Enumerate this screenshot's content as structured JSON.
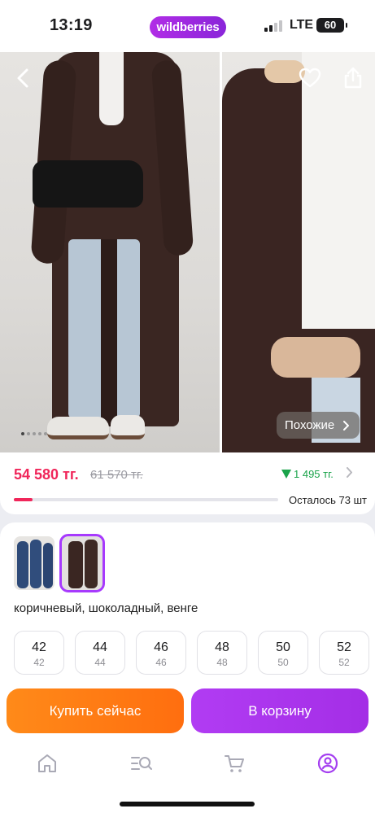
{
  "status_bar": {
    "time": "13:19",
    "brand": "wildberries",
    "network": "LTE",
    "battery": "60"
  },
  "gallery": {
    "back_icon": "chevron-left-icon",
    "favorite_icon": "heart-icon",
    "share_icon": "share-icon",
    "similar_label": "Похожие",
    "page_count": 5,
    "active_page": 1
  },
  "price": {
    "current": "54 580 тг.",
    "old": "61 570 тг.",
    "discount": "1 495 тг.",
    "stock_text": "Осталось 73 шт",
    "stock_progress": 0.07
  },
  "variants": {
    "color_name": "коричневый, шоколадный, венге",
    "sizes": [
      {
        "size": "42",
        "ru": "42"
      },
      {
        "size": "44",
        "ru": "44"
      },
      {
        "size": "46",
        "ru": "46"
      },
      {
        "size": "48",
        "ru": "48"
      },
      {
        "size": "50",
        "ru": "50"
      },
      {
        "size": "52",
        "ru": "52"
      }
    ]
  },
  "actions": {
    "buy_now": "Купить сейчас",
    "add_to_cart": "В корзину"
  },
  "colors": {
    "accent": "#a73afd",
    "price": "#f0265a",
    "discount": "#1aa34a",
    "buy_button": "#ff7a14",
    "cart_button": "#a935ee"
  },
  "nav": [
    "home-icon",
    "catalog-search-icon",
    "cart-icon",
    "profile-icon"
  ]
}
